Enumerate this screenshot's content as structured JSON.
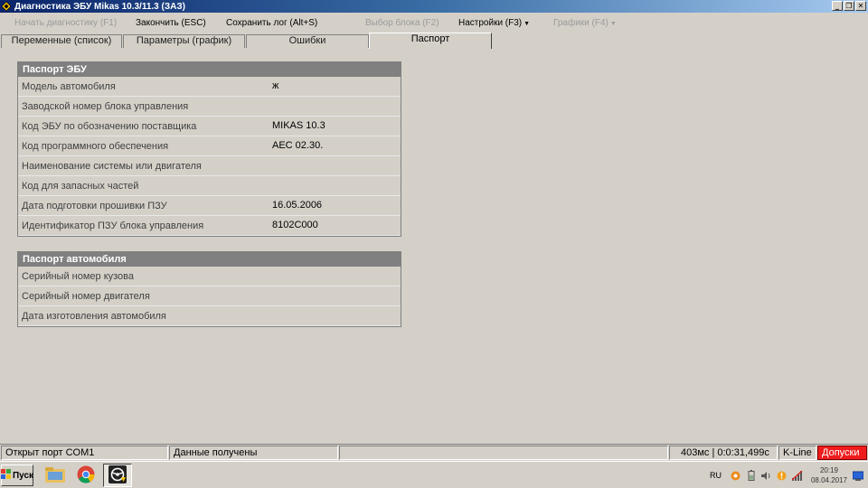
{
  "window": {
    "title": "Диагностика ЭБУ Mikas 10.3/11.3 (ЗАЗ)"
  },
  "menu": [
    {
      "id": "start-diag",
      "label": "Начать диагностику (F1)",
      "disabled": true,
      "dropdown": false
    },
    {
      "id": "finish",
      "label": "Закончить (ESC)",
      "disabled": false,
      "dropdown": false
    },
    {
      "id": "save-log",
      "label": "Сохранить лог (Alt+S)",
      "disabled": false,
      "dropdown": false
    },
    {
      "id": "select-block",
      "label": "Выбор блока (F2)",
      "disabled": true,
      "dropdown": false
    },
    {
      "id": "settings",
      "label": "Настройки (F3)",
      "disabled": false,
      "dropdown": true
    },
    {
      "id": "graphs",
      "label": "Графики (F4)",
      "disabled": true,
      "dropdown": true
    }
  ],
  "tabs": [
    {
      "label": "Переменные (список)",
      "active": false
    },
    {
      "label": "Параметры (график)",
      "active": false
    },
    {
      "label": "Ошибки",
      "active": false
    },
    {
      "label": "Паспорт",
      "active": true
    }
  ],
  "ecu_passport": {
    "title": "Паспорт ЭБУ",
    "rows": [
      {
        "label": "Модель автомобиля",
        "value": "ж"
      },
      {
        "label": "Заводской номер блока управления",
        "value": ""
      },
      {
        "label": "Код ЭБУ по обозначению поставщика",
        "value": "MIKAS 10.3"
      },
      {
        "label": "Код программного обеспечения",
        "value": "AEC 02.30."
      },
      {
        "label": "Наименование системы или двигателя",
        "value": ""
      },
      {
        "label": "Код для запасных частей",
        "value": ""
      },
      {
        "label": "Дата подготовки прошивки ПЗУ",
        "value": "16.05.2006"
      },
      {
        "label": "Идентификатор ПЗУ блока управления",
        "value": "8102C000"
      }
    ]
  },
  "car_passport": {
    "title": "Паспорт автомобиля",
    "rows": [
      {
        "label": "Серийный номер кузова",
        "value": ""
      },
      {
        "label": "Серийный номер двигателя",
        "value": ""
      },
      {
        "label": "Дата изготовления автомобиля",
        "value": ""
      }
    ]
  },
  "status": {
    "port": "Открыт порт COM1",
    "data": "Данные получены",
    "timing": "403мс | 0:0:31,499с",
    "protocol": "K-Line",
    "warning": "Допуски"
  },
  "taskbar": {
    "start_label": "Пуск",
    "lang": "RU",
    "time": "20:19",
    "date": "08.04.2017"
  },
  "colors": {
    "title_start": "#0a246a",
    "title_end": "#a6caf0",
    "panel_header": "#808080",
    "warning_bg": "#ee1c1c"
  }
}
